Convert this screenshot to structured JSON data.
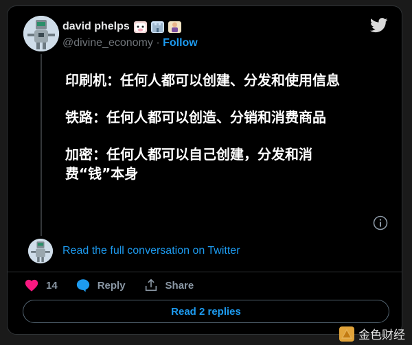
{
  "author": {
    "name": "david phelps",
    "emojis": [
      "cow-emoji",
      "castle-emoji",
      "person-emoji"
    ],
    "handle": "@divine_economy",
    "separator": " · ",
    "follow_label": "Follow"
  },
  "tweet": {
    "paragraphs": [
      "印刷机：任何人都可以创建、分发和使用信息",
      "铁路：任何人都可以创造、分销和消费商品",
      "加密：任何人都可以自己创建，分发和消费“钱”本身"
    ]
  },
  "read_full_label": "Read the full conversation on Twitter",
  "actions": {
    "likes_count": "14",
    "reply_label": "Reply",
    "share_label": "Share"
  },
  "replies_button_label": "Read 2 replies",
  "watermark": {
    "text": "金色财经"
  },
  "colors": {
    "accent": "#1d9bf0",
    "like": "#f91880",
    "background": "#000000"
  }
}
